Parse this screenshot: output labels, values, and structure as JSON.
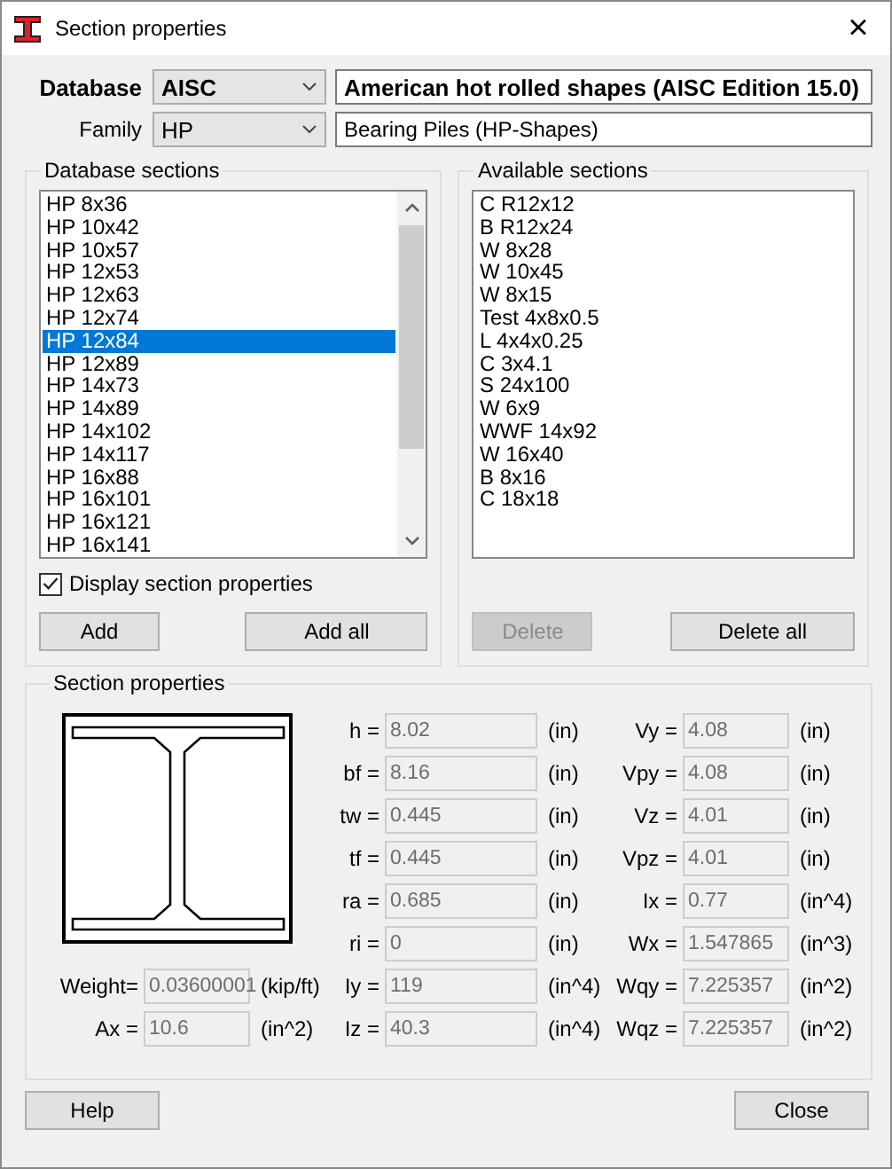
{
  "window": {
    "title": "Section properties",
    "close": "×"
  },
  "database": {
    "label": "Database",
    "value": "AISC",
    "description": "American hot rolled shapes (AISC Edition 15.0)"
  },
  "family": {
    "label": "Family",
    "value": "HP",
    "description": "Bearing Piles (HP-Shapes)"
  },
  "database_sections": {
    "title": "Database sections",
    "items": [
      {
        "label": "HP 8x36",
        "selected": false
      },
      {
        "label": "HP 10x42",
        "selected": false
      },
      {
        "label": "HP 10x57",
        "selected": false
      },
      {
        "label": "HP 12x53",
        "selected": false
      },
      {
        "label": "HP 12x63",
        "selected": false
      },
      {
        "label": "HP 12x74",
        "selected": false
      },
      {
        "label": "HP 12x84",
        "selected": true
      },
      {
        "label": "HP 12x89",
        "selected": false
      },
      {
        "label": "HP 14x73",
        "selected": false
      },
      {
        "label": "HP 14x89",
        "selected": false
      },
      {
        "label": "HP 14x102",
        "selected": false
      },
      {
        "label": "HP 14x117",
        "selected": false
      },
      {
        "label": "HP 16x88",
        "selected": false
      },
      {
        "label": "HP 16x101",
        "selected": false
      },
      {
        "label": "HP 16x121",
        "selected": false
      },
      {
        "label": "HP 16x141",
        "selected": false
      }
    ],
    "display_properties": {
      "label": "Display section properties",
      "checked": true
    },
    "buttons": [
      {
        "label": "Add",
        "disabled": false
      },
      {
        "label": "Add all",
        "disabled": false
      }
    ]
  },
  "available_sections": {
    "title": "Available sections",
    "items": [
      "C R12x12",
      "B R12x24",
      "W 8x28",
      "W 10x45",
      "W 8x15",
      "Test 4x8x0.5",
      "L 4x4x0.25",
      "C 3x4.1",
      "S 24x100",
      "W 6x9",
      "WWF 14x92",
      "W 16x40",
      "B 8x16",
      "C 18x18"
    ],
    "buttons": [
      {
        "label": "Delete",
        "disabled": true
      },
      {
        "label": "Delete all",
        "disabled": false
      }
    ]
  },
  "section_properties": {
    "title": "Section properties",
    "left": [
      {
        "label": "Weight=",
        "value": "0.03600001",
        "unit": "(kip/ft)"
      },
      {
        "label": "Ax =",
        "value": "10.6",
        "unit": "(in^2)"
      }
    ],
    "middle": [
      {
        "label": "h =",
        "value": "8.02",
        "unit": "(in)"
      },
      {
        "label": "bf =",
        "value": "8.16",
        "unit": "(in)"
      },
      {
        "label": "tw =",
        "value": "0.445",
        "unit": "(in)"
      },
      {
        "label": "tf =",
        "value": "0.445",
        "unit": "(in)"
      },
      {
        "label": "ra =",
        "value": "0.685",
        "unit": "(in)"
      },
      {
        "label": "ri =",
        "value": "0",
        "unit": "(in)"
      },
      {
        "label": "Iy =",
        "value": "119",
        "unit": "(in^4)"
      },
      {
        "label": "Iz =",
        "value": "40.3",
        "unit": "(in^4)"
      }
    ],
    "right": [
      {
        "label": "Vy =",
        "value": "4.08",
        "unit": "(in)"
      },
      {
        "label": "Vpy =",
        "value": "4.08",
        "unit": "(in)"
      },
      {
        "label": "Vz =",
        "value": "4.01",
        "unit": "(in)"
      },
      {
        "label": "Vpz =",
        "value": "4.01",
        "unit": "(in)"
      },
      {
        "label": "Ix =",
        "value": "0.77",
        "unit": "(in^4)"
      },
      {
        "label": "Wx =",
        "value": "1.547865",
        "unit": "(in^3)"
      },
      {
        "label": "Wqy =",
        "value": "7.225357",
        "unit": "(in^2)"
      },
      {
        "label": "Wqz =",
        "value": "7.225357",
        "unit": "(in^2)"
      }
    ]
  },
  "footer_buttons": [
    {
      "label": "Help"
    },
    {
      "label": "Close"
    }
  ]
}
